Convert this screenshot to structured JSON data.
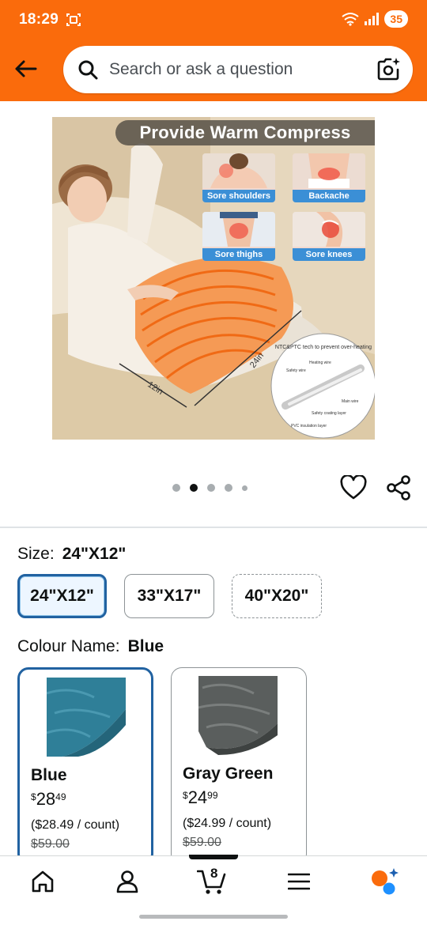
{
  "status_bar": {
    "time": "18:29",
    "battery": "35"
  },
  "search": {
    "placeholder": "Search or ask a question"
  },
  "product_image": {
    "caption": "Provide Warm Compress",
    "tiles": [
      {
        "label": "Sore shoulders"
      },
      {
        "label": "Backache"
      },
      {
        "label": "Sore thighs"
      },
      {
        "label": "Sore knees"
      }
    ],
    "dim_length": "24in",
    "dim_width": "12in",
    "inset_title": "NTC&PTC tech to prevent over-heating",
    "inset_labels": [
      "Heating wire",
      "Safety wire",
      "Main wire",
      "Safety coating layer",
      "PVC insulation layer"
    ]
  },
  "carousel": {
    "page_count": 5,
    "active_index": 1
  },
  "size": {
    "label": "Size:",
    "selected": "24\"X12\"",
    "options": [
      {
        "label": "24\"X12\"",
        "state": "selected"
      },
      {
        "label": "33\"X17\"",
        "state": "available"
      },
      {
        "label": "40\"X20\"",
        "state": "unavailable"
      }
    ]
  },
  "colour": {
    "label": "Colour Name:",
    "selected": "Blue",
    "options": [
      {
        "name": "Blue",
        "currency": "$",
        "dollars": "28",
        "cents": "49",
        "unit_price": "($28.49 / count)",
        "was_price": "$59.00",
        "swatch_color": "#2f7f98"
      },
      {
        "name": "Gray Green",
        "currency": "$",
        "dollars": "24",
        "cents": "99",
        "unit_price": "($24.99 / count)",
        "was_price": "$59.00",
        "swatch_color": "#5a5e5d"
      }
    ]
  },
  "bottom_nav": {
    "cart_count": "8"
  },
  "colors": {
    "brand_orange": "#fa6b0c",
    "selected_border": "#2162a1"
  }
}
